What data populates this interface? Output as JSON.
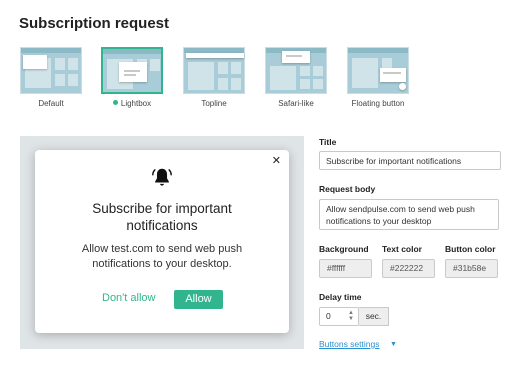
{
  "page": {
    "title": "Subscription request"
  },
  "options": [
    {
      "label": "Default",
      "selected": false
    },
    {
      "label": "Lightbox",
      "selected": true
    },
    {
      "label": "Topline",
      "selected": false
    },
    {
      "label": "Safari-like",
      "selected": false
    },
    {
      "label": "Floating button",
      "selected": false
    }
  ],
  "preview": {
    "title": "Subscribe for important notifications",
    "body": "Allow test.com to send web push notifications to your desktop.",
    "deny_label": "Don't allow",
    "allow_label": "Allow",
    "close_glyph": "✕"
  },
  "form": {
    "title_label": "Title",
    "title_value": "Subscribe for important notifications",
    "body_label": "Request body",
    "body_value": "Allow sendpulse.com to send web push notifications to your desktop",
    "background_label": "Background",
    "background_value": "#ffffff",
    "text_color_label": "Text color",
    "text_color_value": "#222222",
    "button_color_label": "Button color",
    "button_color_value": "#31b58e",
    "delay_label": "Delay time",
    "delay_value": "0",
    "delay_unit": "sec.",
    "buttons_settings_label": "Buttons settings"
  },
  "colors": {
    "accent": "#31b58e",
    "link": "#2b8fd0",
    "preview_bg": "#dfe4e6"
  }
}
